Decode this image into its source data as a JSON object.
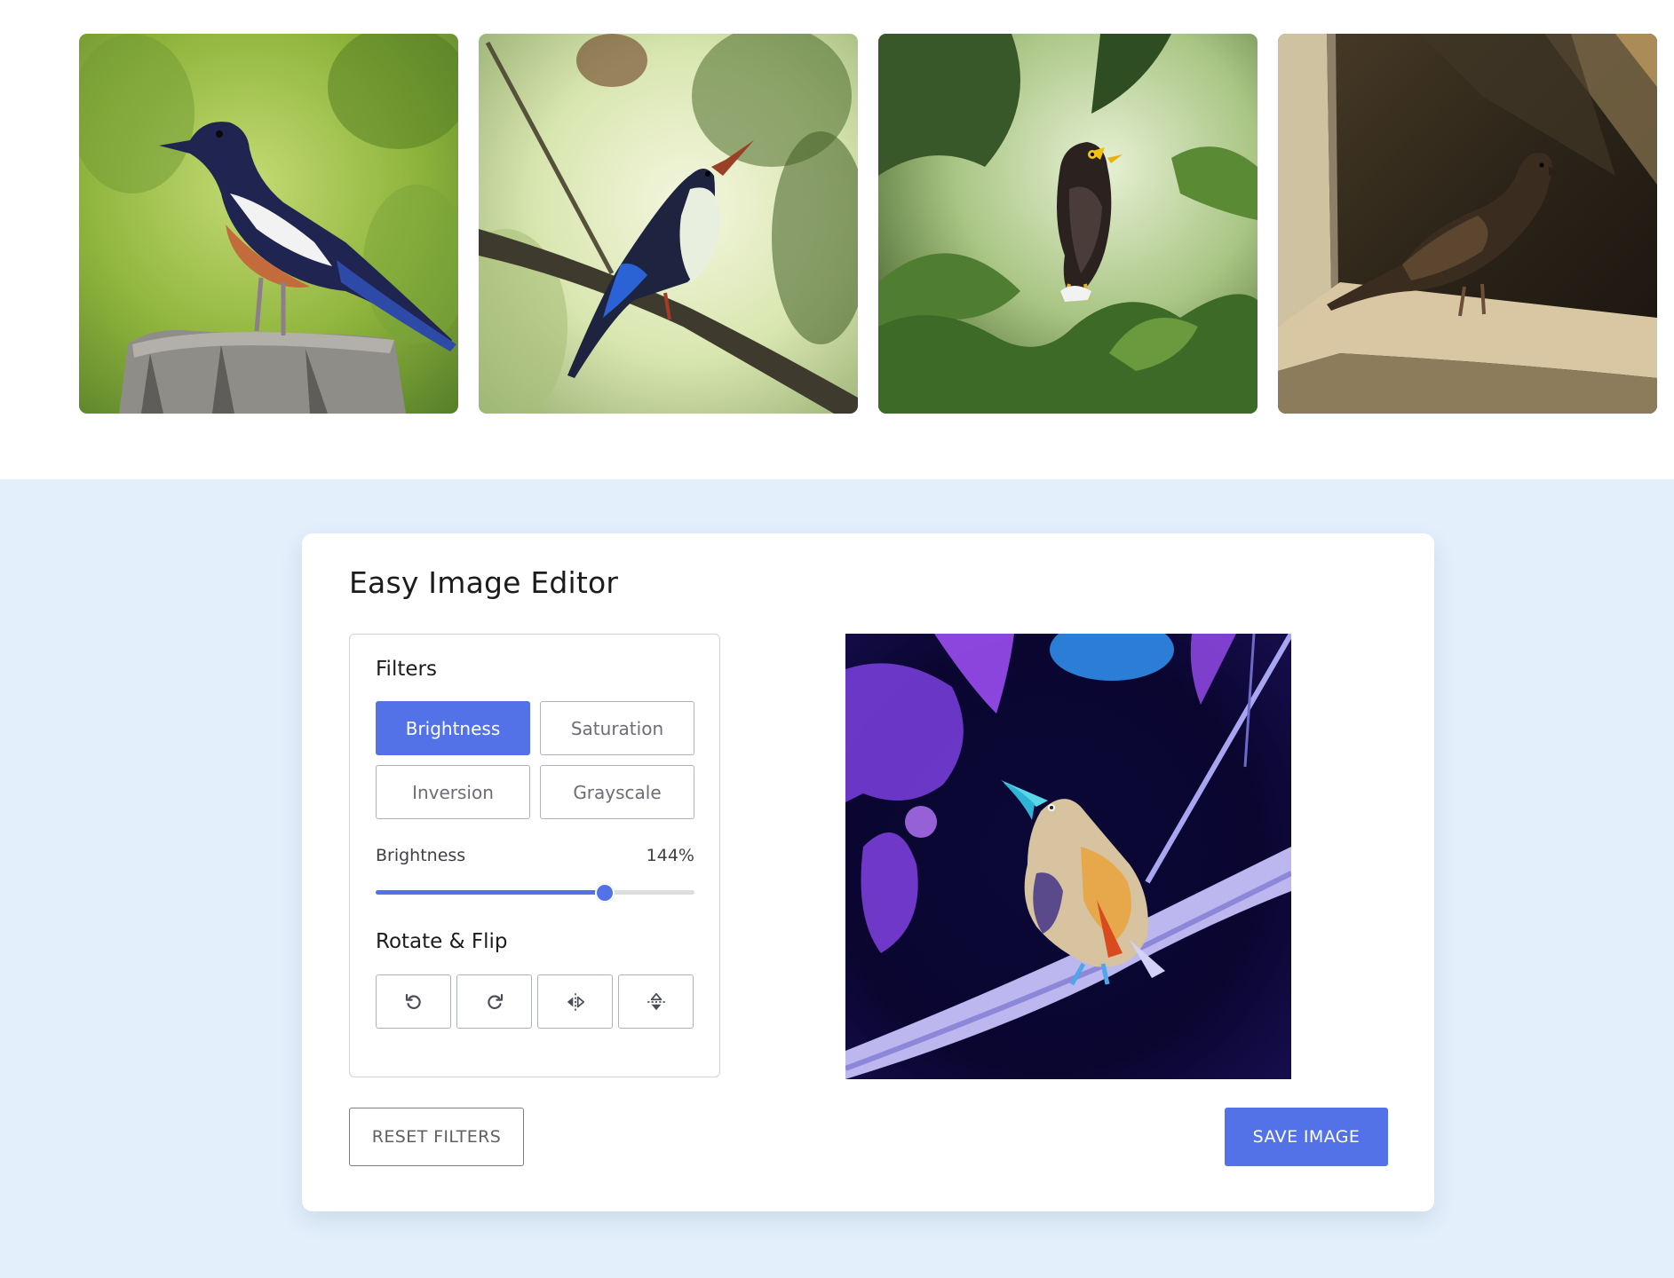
{
  "gallery": {
    "images": [
      {
        "alt": "Magpie robin on stump"
      },
      {
        "alt": "Kingfisher on branch"
      },
      {
        "alt": "Myna among leaves"
      },
      {
        "alt": "Dove on ledge"
      }
    ]
  },
  "editor": {
    "title": "Easy Image Editor",
    "filters": {
      "heading": "Filters",
      "buttons": [
        {
          "label": "Brightness",
          "active": true
        },
        {
          "label": "Saturation",
          "active": false
        },
        {
          "label": "Inversion",
          "active": false
        },
        {
          "label": "Grayscale",
          "active": false
        }
      ]
    },
    "slider": {
      "name": "Brightness",
      "value_text": "144%",
      "value": 144,
      "min": 0,
      "max": 200
    },
    "rotate_flip": {
      "heading": "Rotate & Flip",
      "buttons": [
        {
          "icon": "rotate-left-icon"
        },
        {
          "icon": "rotate-right-icon"
        },
        {
          "icon": "flip-horizontal-icon"
        },
        {
          "icon": "flip-vertical-icon"
        }
      ]
    },
    "reset_label": "RESET FILTERS",
    "save_label": "SAVE IMAGE"
  },
  "colors": {
    "accent": "#5372e8",
    "section_bg": "#e3effb",
    "card_bg": "#ffffff"
  }
}
